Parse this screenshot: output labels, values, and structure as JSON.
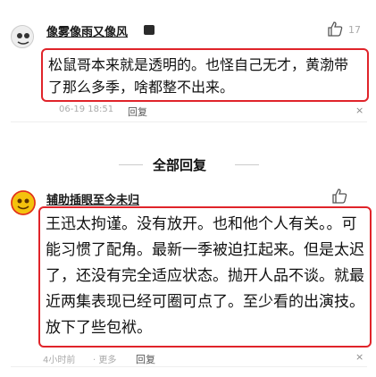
{
  "comments": [
    {
      "username": "像雾像雨又像风",
      "text": "松鼠哥本来就是透明的。也怪自己无才，黄渤带了那么多季，啥都整不出来。",
      "likes": "17",
      "meta": "06-19 18:51",
      "reply_label": "回复",
      "close": "×"
    },
    {
      "username": "辅助插眼至今未归",
      "text": "王迅太拘谨。没有放开。也和他个人有关。。可能习惯了配角。最新一季被迫扛起来。但是太迟了，还没有完全适应状态。抛开人品不谈。就最近两集表现已经可圈可点了。至少看的出演技。放下了些包袱。",
      "meta": "4小时前",
      "more_label": "· 更多",
      "reply_label": "回复",
      "close": "×"
    }
  ],
  "section": {
    "title": "全部回复"
  },
  "colors": {
    "highlight_border": "#e0242a",
    "muted_text": "#aaaaaa"
  }
}
